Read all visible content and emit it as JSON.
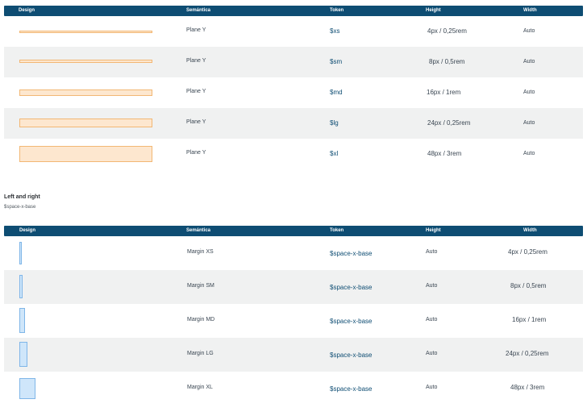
{
  "table_y": {
    "headers": {
      "design": "Design",
      "semantica": "Semántica",
      "token": "Token",
      "height": "Height",
      "width": "Width"
    },
    "rows": [
      {
        "semantica": "Plane Y",
        "token": "$xs",
        "height": "4px / 0,25rem",
        "width": "Auto"
      },
      {
        "semantica": "Plane Y",
        "token": "$sm",
        "height": "8px / 0,5rem",
        "width": "Auto"
      },
      {
        "semantica": "Plane Y",
        "token": "$md",
        "height": "16px / 1rem",
        "width": "Auto"
      },
      {
        "semantica": "Plane Y",
        "token": "$lg",
        "height": "24px / 0,25rem",
        "width": "Auto"
      },
      {
        "semantica": "Plane Y",
        "token": "$xl",
        "height": "48px / 3rem",
        "width": "Auto"
      }
    ]
  },
  "section": {
    "title": "Left and right",
    "subtitle": "$space-x-base"
  },
  "table_x": {
    "headers": {
      "design": "Design",
      "semantica": "Semántica",
      "token": "Token",
      "height": "Height",
      "width": "Width"
    },
    "rows": [
      {
        "semantica": "Margin XS",
        "token": "$space-x-base",
        "height": "Auto",
        "width": "4px / 0,25rem"
      },
      {
        "semantica": "Margin SM",
        "token": "$space-x-base",
        "height": "Auto",
        "width": "8px / 0,5rem"
      },
      {
        "semantica": "Margin MD",
        "token": "$space-x-base",
        "height": "Auto",
        "width": "16px / 1rem"
      },
      {
        "semantica": "Margin LG",
        "token": "$space-x-base",
        "height": "Auto",
        "width": "24px / 0,25rem"
      },
      {
        "semantica": "Margin XL",
        "token": "$space-x-base",
        "height": "Auto",
        "width": "48px / 3rem"
      }
    ]
  },
  "colors": {
    "header_bg": "#0e4d73",
    "token_text": "#0e4d73",
    "stripe_bg": "#f0f1f1",
    "swatch_y_fill": "#fde7cf",
    "swatch_y_border": "#f2b774",
    "swatch_x_fill": "#cfe6fa",
    "swatch_x_border": "#7fb6e8"
  }
}
